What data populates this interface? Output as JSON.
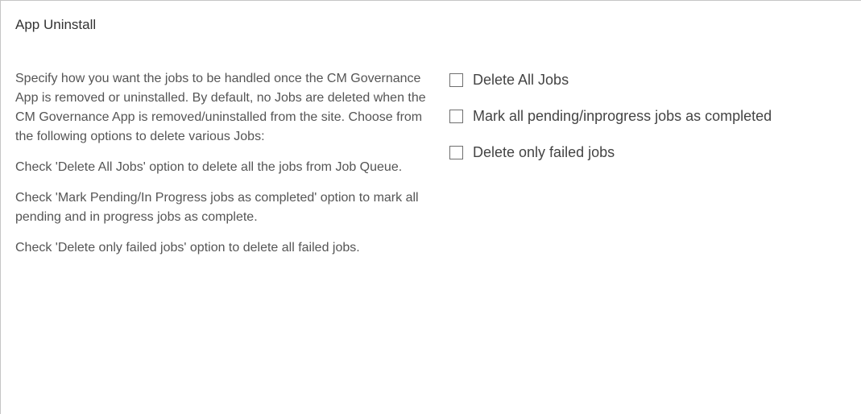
{
  "section": {
    "title": "App Uninstall"
  },
  "description": {
    "paragraphs": [
      "Specify how you want the jobs to be handled once the CM Governance App is removed or uninstalled. By default, no Jobs are deleted when the CM Governance App is removed/uninstalled from the site. Choose from the following options to delete various Jobs:",
      "Check 'Delete All Jobs' option to delete all the jobs from Job Queue.",
      "Check 'Mark Pending/In Progress jobs as completed' option to mark all pending and in progress jobs as complete.",
      "Check 'Delete only failed jobs' option to delete all failed jobs."
    ]
  },
  "options": [
    {
      "label": "Delete All Jobs",
      "checked": false,
      "icon": "checkbox-unchecked-icon"
    },
    {
      "label": "Mark all pending/inprogress jobs as completed",
      "checked": false,
      "icon": "checkbox-unchecked-icon"
    },
    {
      "label": "Delete only failed jobs",
      "checked": false,
      "icon": "checkbox-unchecked-icon"
    }
  ],
  "colors": {
    "border": "#c6c6c6",
    "text": "#444444",
    "checkbox_border": "#6f6f6f"
  }
}
